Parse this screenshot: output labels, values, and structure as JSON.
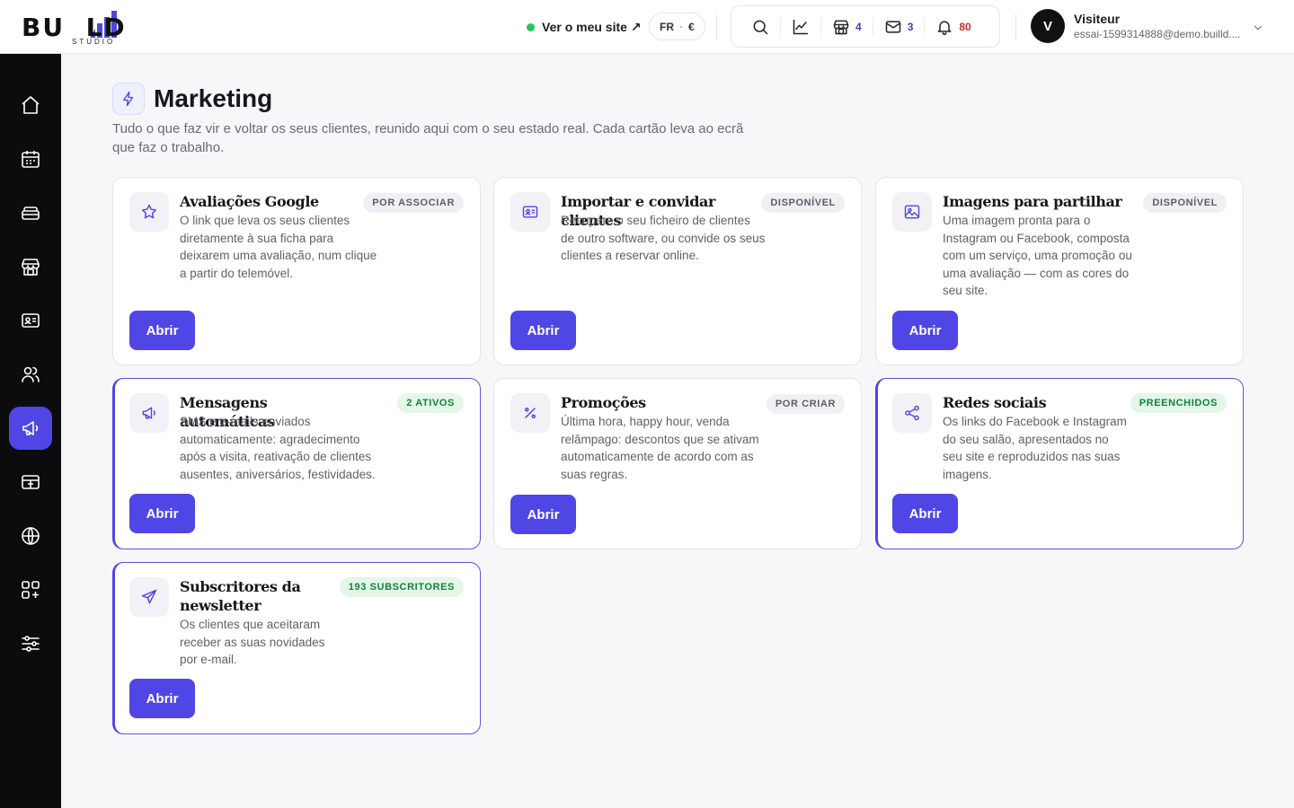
{
  "brand": {
    "word": "BU  LD",
    "sub": "STUDIO"
  },
  "header": {
    "site_link": "Ver o meu site ↗",
    "locale_lang": "FR",
    "locale_sep": "·",
    "locale_currency": "€",
    "counts": {
      "shop": "4",
      "mail": "3",
      "notifications": "80"
    },
    "user": {
      "initial": "V",
      "name": "Visiteur",
      "email": "essai-1599314888@demo.builld...."
    }
  },
  "sidebar": {
    "items": [
      {
        "icon": "home-icon"
      },
      {
        "icon": "calendar-icon"
      },
      {
        "icon": "services-icon"
      },
      {
        "icon": "store-icon"
      },
      {
        "icon": "contact-card-icon"
      },
      {
        "icon": "users-icon"
      },
      {
        "icon": "megaphone-icon",
        "active": true
      },
      {
        "icon": "payment-icon"
      },
      {
        "icon": "globe-icon"
      },
      {
        "icon": "apps-icon"
      },
      {
        "icon": "settings-sliders-icon"
      }
    ]
  },
  "page": {
    "title": "Marketing",
    "description": "Tudo o que faz vir e voltar os seus clientes, reunido aqui com o seu estado real. Cada cartão leva ao ecrã que faz o trabalho."
  },
  "cards": [
    {
      "title": "Avaliações Google",
      "badge": "POR ASSOCIAR",
      "desc": "O link que leva os seus clientes diretamente à sua ficha para deixarem uma avaliação, num clique a partir do telemóvel.",
      "button": "Abrir",
      "icon": "star-icon"
    },
    {
      "title": "Importar e convidar clientes",
      "badge": "DISPONÍVEL",
      "desc": "Recupere o seu ficheiro de clientes de outro software, ou convide os seus clientes a reservar online.",
      "button": "Abrir",
      "icon": "id-card-icon"
    },
    {
      "title": "Imagens para partilhar",
      "badge": "DISPONÍVEL",
      "desc": "Uma imagem pronta para o Instagram ou Facebook, composta com um serviço, uma promoção ou uma avaliação — com as cores do seu site.",
      "button": "Abrir",
      "icon": "image-icon"
    },
    {
      "title": "Mensagens automáticas",
      "badge": "2 ATIVOS",
      "desc": "SMS e e-mails enviados automaticamente: agradecimento após a visita, reativação de clientes ausentes, aniversários, festividades.",
      "button": "Abrir",
      "icon": "megaphone-icon"
    },
    {
      "title": "Promoções",
      "badge": "POR CRIAR",
      "desc": "Última hora, happy hour, venda relâmpago: descontos que se ativam automaticamente de acordo com as suas regras.",
      "button": "Abrir",
      "icon": "percent-icon"
    },
    {
      "title": "Redes sociais",
      "badge": "PREENCHIDOS",
      "desc": "Os links do Facebook e Instagram do seu salão, apresentados no seu site e reproduzidos nas suas imagens.",
      "button": "Abrir",
      "icon": "share-icon"
    },
    {
      "title": "Subscritores da newsletter",
      "badge": "193 SUBSCRITORES",
      "desc": "Os clientes que aceitaram receber as suas novidades por e-mail.",
      "button": "Abrir",
      "icon": "send-icon"
    }
  ],
  "colors": {
    "accent": "#4f46e5",
    "sidebar": "#0c0c0e",
    "green": "#22c55e",
    "alert": "#dc2626"
  }
}
